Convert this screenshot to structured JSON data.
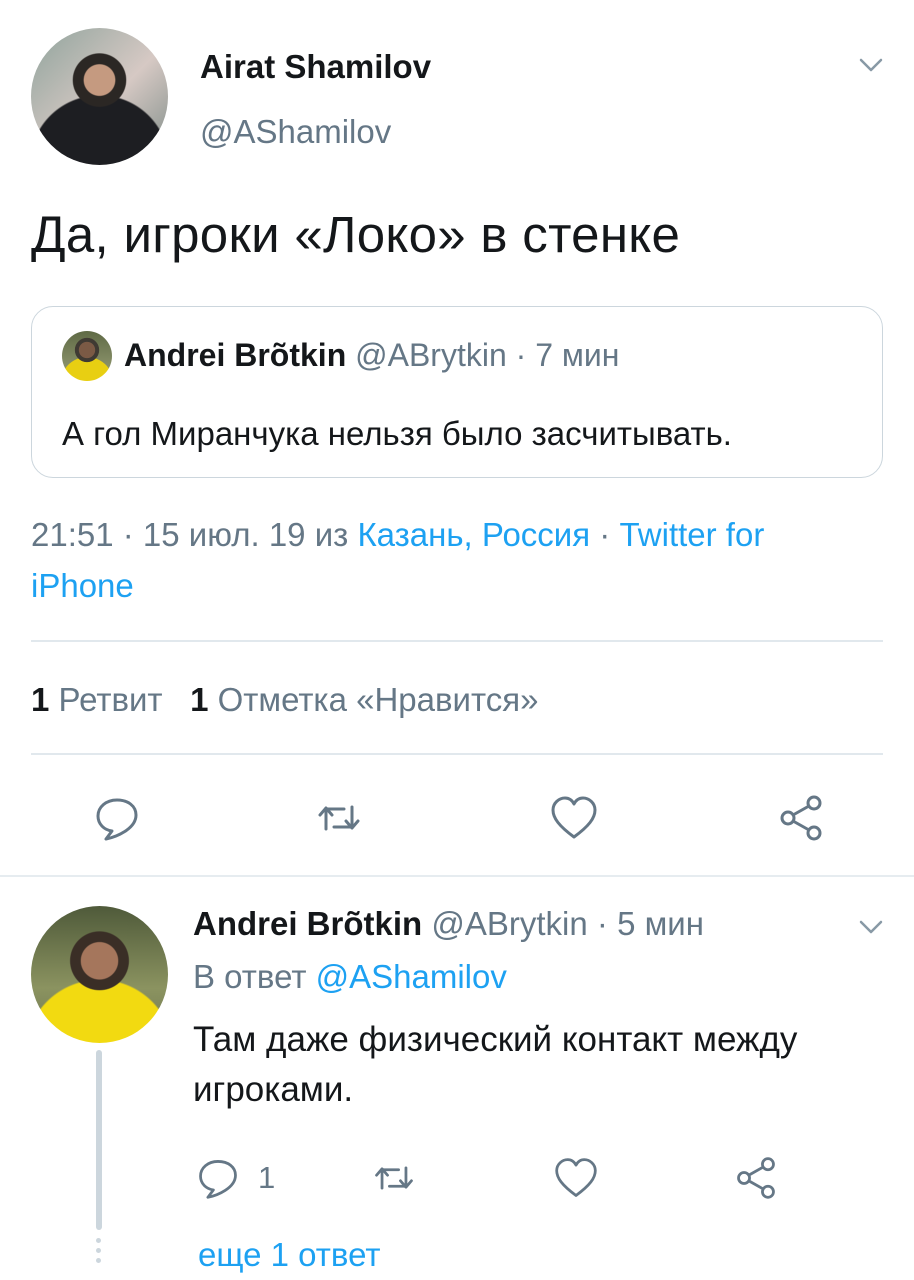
{
  "main_tweet": {
    "author_name": "Airat Shamilov",
    "author_handle": "@AShamilov",
    "text": "Да, игроки «Локо» в стенке",
    "quoted": {
      "author_name": "Andrei Brõtkin",
      "author_handle": "@ABrytkin",
      "time": "· 7 мин",
      "text": "А гол Миранчука нельзя было засчитывать."
    },
    "meta": {
      "time": "21:51 · 15 июл. 19 из ",
      "location": "Казань, Россия",
      "separator": " · ",
      "source_part1": "Twitter for",
      "source_part2": "iPhone"
    },
    "stats": {
      "retweet_count": "1",
      "retweet_label": "Ретвит",
      "like_count": "1",
      "like_label": "Отметка «Нравится»"
    }
  },
  "reply_tweet": {
    "author_name": "Andrei Brõtkin",
    "author_handle": "@ABrytkin",
    "time": "· 5 мин",
    "reply_prefix": "В ответ ",
    "reply_to_handle": "@AShamilov",
    "text": "Там даже физический контакт между игроками.",
    "reply_count": "1"
  },
  "more_replies": "еще 1 ответ",
  "icons": {
    "chevron": "chevron-down-icon",
    "reply": "reply-icon",
    "retweet": "retweet-icon",
    "like": "heart-icon",
    "share": "share-icon"
  },
  "colors": {
    "accent": "#1da1f2",
    "secondary_text": "#657786",
    "primary_text": "#14171a",
    "border": "#ccd6dd"
  }
}
